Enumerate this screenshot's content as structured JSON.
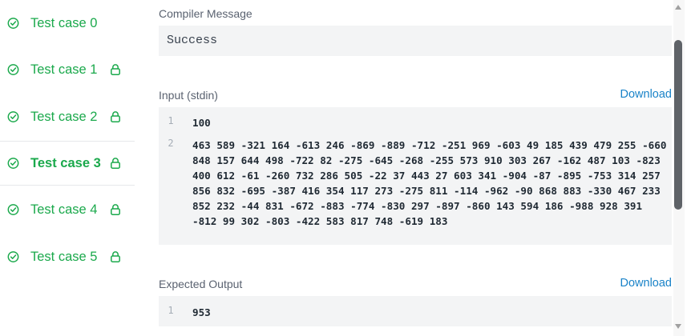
{
  "sidebar": {
    "accent_color": "#1ba94c",
    "test_cases": [
      {
        "label": "Test case 0",
        "locked": false,
        "active": false
      },
      {
        "label": "Test case 1",
        "locked": true,
        "active": false
      },
      {
        "label": "Test case 2",
        "locked": true,
        "active": false
      },
      {
        "label": "Test case 3",
        "locked": true,
        "active": true
      },
      {
        "label": "Test case 4",
        "locked": true,
        "active": false
      },
      {
        "label": "Test case 5",
        "locked": true,
        "active": false
      }
    ]
  },
  "compiler": {
    "label": "Compiler Message",
    "message": "Success"
  },
  "input": {
    "label": "Input (stdin)",
    "download_label": "Download",
    "lines": [
      {
        "num": "1",
        "text": "100"
      },
      {
        "num": "2",
        "text": "463 589 -321 164 -613 246 -869 -889 -712 -251 969 -603 49 185 439 479 255 -660 848 157 644 498 -722 82 -275 -645 -268 -255 573 910 303 267 -162 487 103 -823 400 612 -61 -260 732 286 505 -22 37 443 27 603 341 -904 -87 -895 -753 314 257 856 832 -695 -387 416 354 117 273 -275 811 -114 -962 -90 868 883 -330 467 233 852 232 -44 831 -672 -883 -774 -830 297 -897 -860 143 594 186 -988 928 391 -812 99 302 -803 -422 583 817 748 -619 183"
      }
    ]
  },
  "expected": {
    "label": "Expected Output",
    "download_label": "Download",
    "lines": [
      {
        "num": "1",
        "text": "953"
      }
    ]
  },
  "colors": {
    "link": "#1a83c8",
    "code_bg": "#f3f4f5"
  }
}
